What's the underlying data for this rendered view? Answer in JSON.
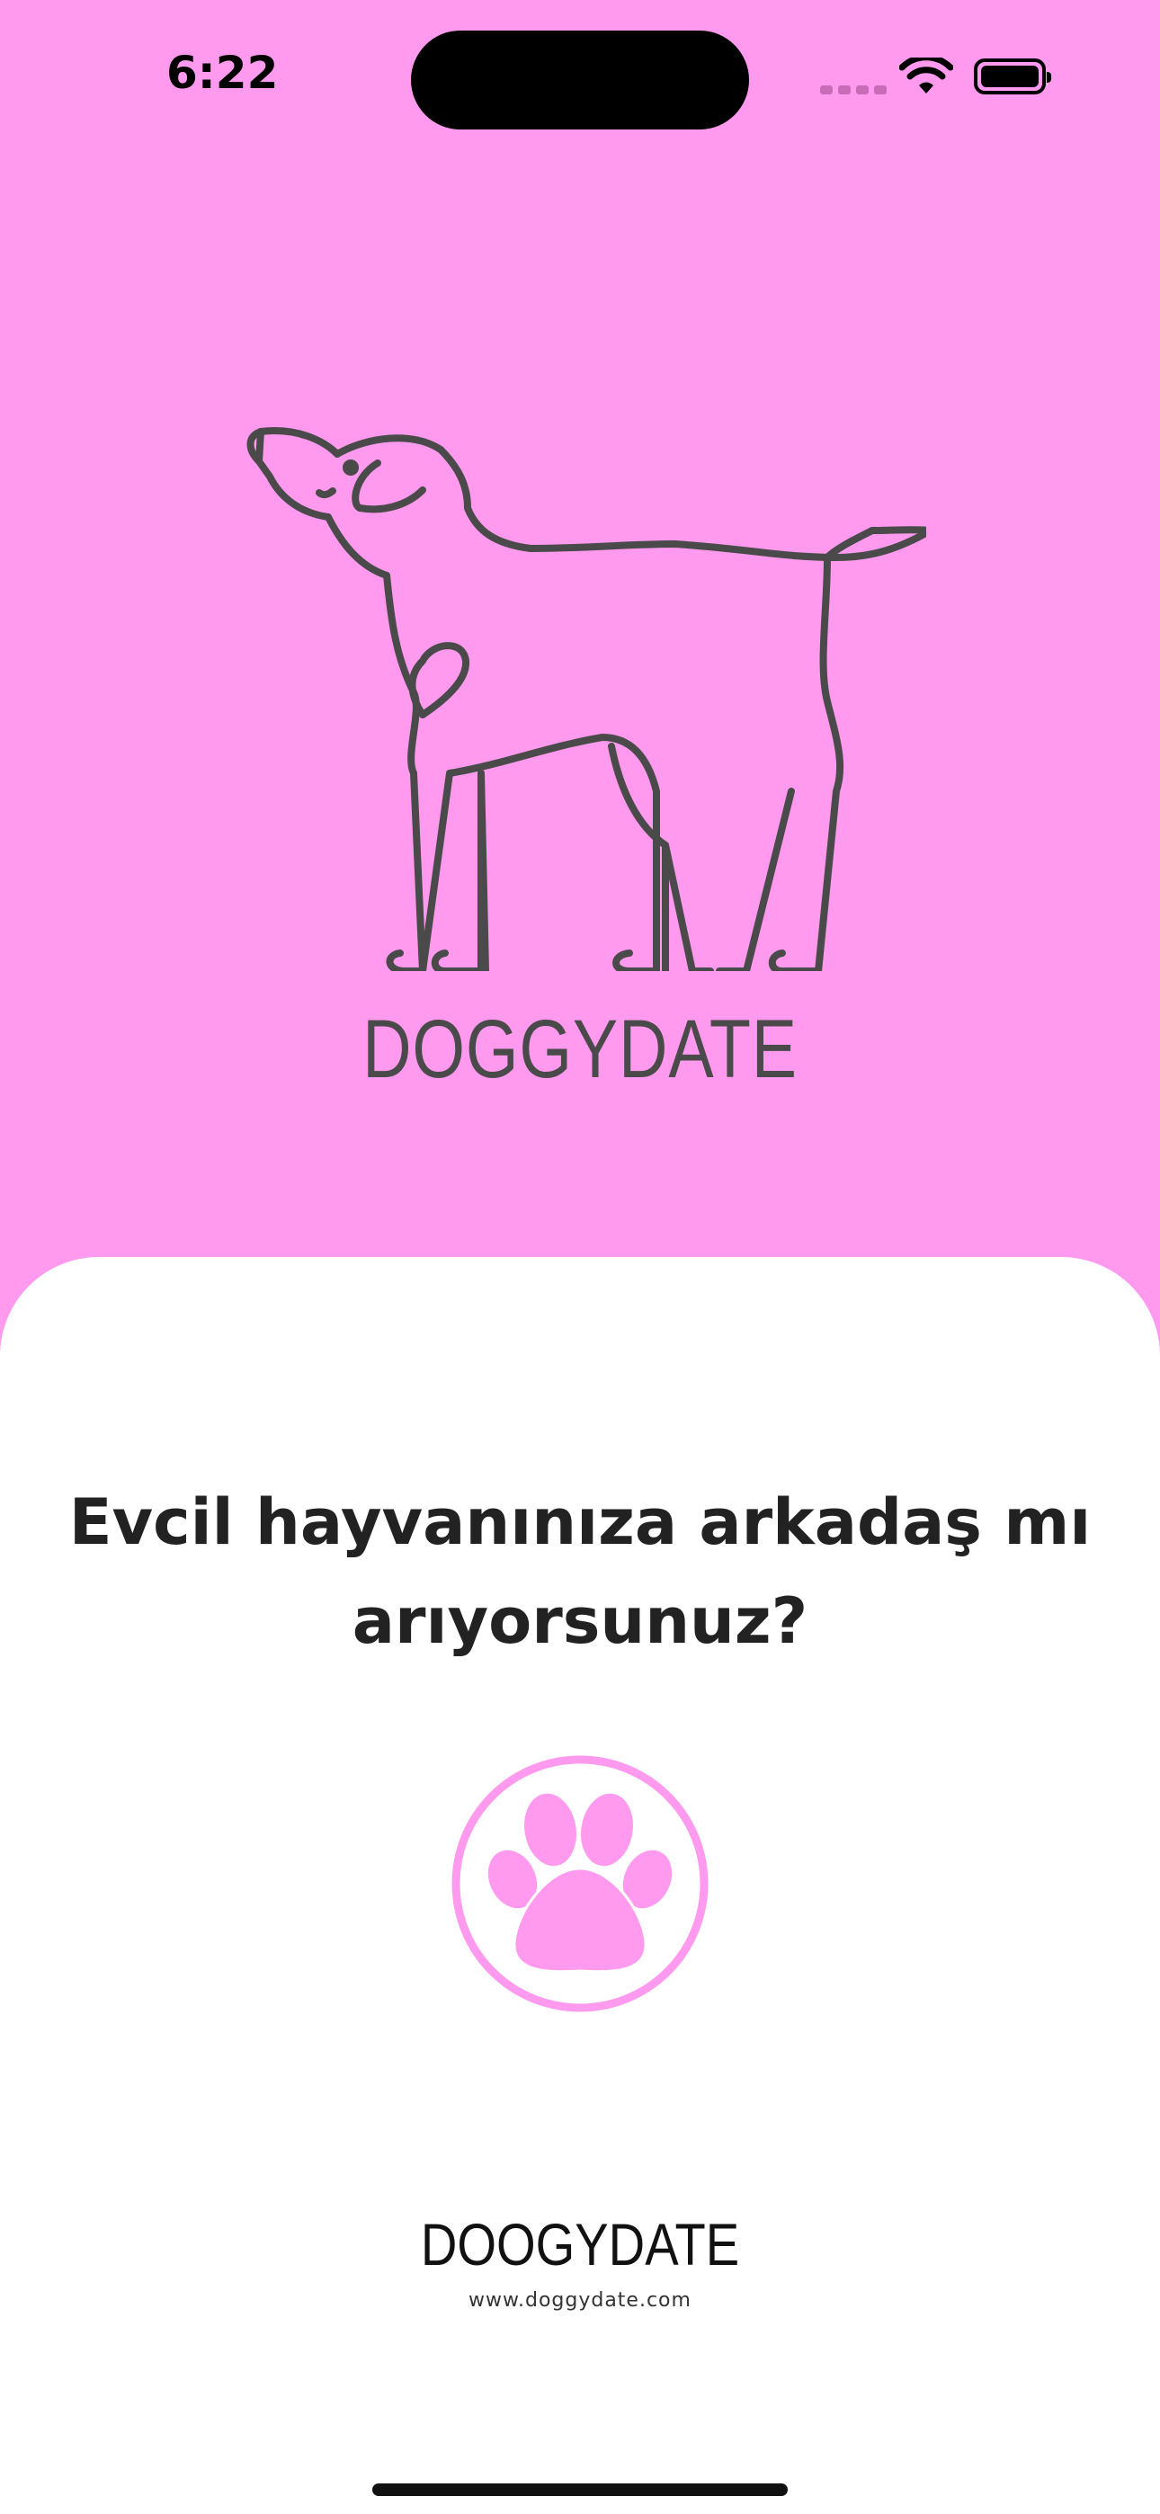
{
  "status_bar": {
    "time": "6:22",
    "icons": [
      "cellular-signal-icon",
      "wifi-icon",
      "battery-icon"
    ]
  },
  "hero": {
    "illustration": "dog-with-heart-illustration",
    "logo_title": "DOGGYDATE"
  },
  "sheet": {
    "headline": "Evcil hayvanınıza arkadaş mı arıyorsunuz?",
    "badge_icon": "paw-icon",
    "footer_brand": "DOOGYDATE",
    "footer_url": "www.doggydate.com"
  },
  "colors": {
    "background_pink": "#ff9aee",
    "paw_pink": "#ff9aee",
    "outline_gray": "#4a4a4a",
    "sheet_white": "#ffffff"
  }
}
